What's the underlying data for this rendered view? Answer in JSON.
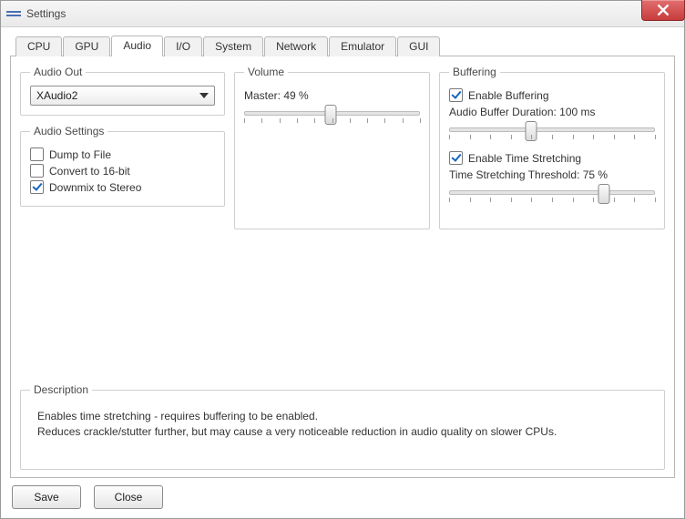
{
  "window": {
    "title": "Settings"
  },
  "tabs": {
    "items": [
      "CPU",
      "GPU",
      "Audio",
      "I/O",
      "System",
      "Network",
      "Emulator",
      "GUI"
    ],
    "active_index": 2
  },
  "audio_out": {
    "legend": "Audio Out",
    "selected": "XAudio2"
  },
  "audio_settings": {
    "legend": "Audio Settings",
    "dump": {
      "label": "Dump to File",
      "checked": false
    },
    "convert": {
      "label": "Convert to 16-bit",
      "checked": false
    },
    "downmix": {
      "label": "Downmix to Stereo",
      "checked": true
    }
  },
  "volume": {
    "legend": "Volume",
    "master_label": "Master: 49 %",
    "master_value": 49
  },
  "buffering": {
    "legend": "Buffering",
    "enable": {
      "label": "Enable Buffering",
      "checked": true
    },
    "duration_label": "Audio Buffer Duration: 100 ms",
    "duration_pct": 40,
    "stretch_enable": {
      "label": "Enable Time Stretching",
      "checked": true
    },
    "stretch_label": "Time Stretching Threshold: 75 %",
    "stretch_pct": 75
  },
  "description": {
    "legend": "Description",
    "line1": "Enables time stretching - requires buffering to be enabled.",
    "line2": "Reduces crackle/stutter further, but may cause a very noticeable reduction in audio quality on slower CPUs."
  },
  "footer": {
    "save": "Save",
    "close": "Close"
  }
}
